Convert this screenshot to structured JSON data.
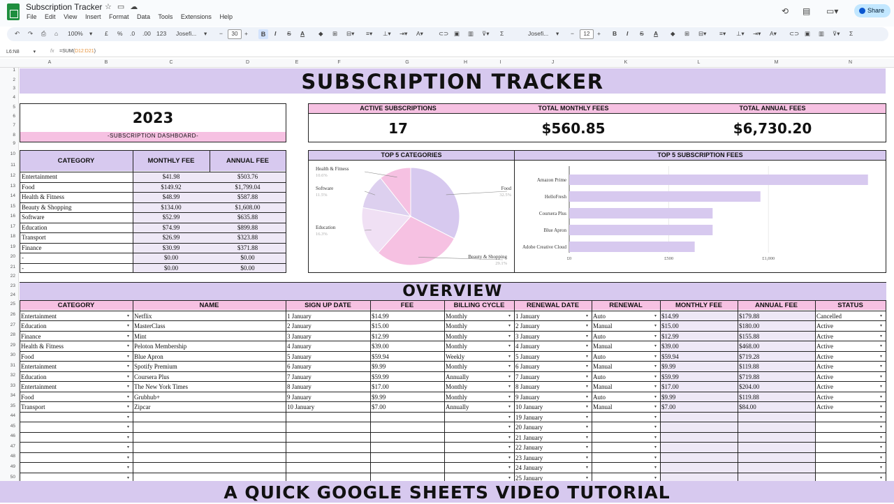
{
  "app": {
    "doc_title": "Subscription Tracker",
    "menu": [
      "File",
      "Edit",
      "View",
      "Insert",
      "Format",
      "Data",
      "Tools",
      "Extensions",
      "Help"
    ],
    "share_label": "Share"
  },
  "toolbar": {
    "zoom": "100%",
    "currency": "£",
    "percent": "%",
    "dec_less": ".0",
    "dec_more": ".00",
    "format_num": "123",
    "font_left": "Josefi...",
    "size_left": "30",
    "font_right": "Josefi...",
    "size_right": "12"
  },
  "formula_bar": {
    "name_box": "L6:N8",
    "fx": "fx",
    "formula_prefix": "=SUM(",
    "formula_range": "D12:D21",
    "formula_suffix": ")"
  },
  "columns": [
    "A",
    "B",
    "C",
    "D",
    "E",
    "F",
    "G",
    "H",
    "I",
    "J",
    "K",
    "L",
    "M",
    "N"
  ],
  "rows": [
    "1",
    "2",
    "3",
    "4",
    "5",
    "6",
    "7",
    "8",
    "9",
    "10",
    "11",
    "12",
    "13",
    "14",
    "15",
    "16",
    "17",
    "18",
    "19",
    "20",
    "21",
    "22",
    "23",
    "24",
    "25",
    "26",
    "27",
    "28",
    "29",
    "30",
    "31",
    "32",
    "33",
    "34",
    "35",
    "44",
    "45",
    "46",
    "47",
    "48",
    "49",
    "50"
  ],
  "header": {
    "title": "SUBSCRIPTION TRACKER"
  },
  "dashboard": {
    "year": "2023",
    "subtitle": "-SUBSCRIPTION DASHBOARD-",
    "kpis": [
      {
        "label": "ACTIVE SUBSCRIPTIONS",
        "value": "17"
      },
      {
        "label": "TOTAL MONTHLY FEES",
        "value": "$560.85"
      },
      {
        "label": "TOTAL ANNUAL FEES",
        "value": "$6,730.20"
      }
    ]
  },
  "category_table": {
    "headers": [
      "CATEGORY",
      "MONTHLY FEE",
      "ANNUAL FEE"
    ],
    "rows": [
      [
        "Entertainment",
        "$41.98",
        "$503.76"
      ],
      [
        "Food",
        "$149.92",
        "$1,799.04"
      ],
      [
        "Health & Fitness",
        "$48.99",
        "$587.88"
      ],
      [
        "Beauty & Shopping",
        "$134.00",
        "$1,608.00"
      ],
      [
        "Software",
        "$52.99",
        "$635.88"
      ],
      [
        "Education",
        "$74.99",
        "$899.88"
      ],
      [
        "Transport",
        "$26.99",
        "$323.88"
      ],
      [
        "Finance",
        "$30.99",
        "$371.88"
      ],
      [
        "-",
        "$0.00",
        "$0.00"
      ],
      [
        "-",
        "$0.00",
        "$0.00"
      ]
    ]
  },
  "chart_data": [
    {
      "type": "pie",
      "title": "TOP 5 CATEGORIES",
      "categories": [
        "Food",
        "Beauty & Shopping",
        "Education",
        "Software",
        "Health & Fitness"
      ],
      "values": [
        32.5,
        29.1,
        16.3,
        11.5,
        10.6
      ],
      "labels": [
        "32.5%",
        "29.1%",
        "16.3%",
        "11.5%",
        "10.6%"
      ],
      "colors": [
        "#d7c9ef",
        "#f6c1e2",
        "#f0e0f4",
        "#ddd0ef",
        "#f6c1e2"
      ]
    },
    {
      "type": "bar",
      "orientation": "horizontal",
      "title": "TOP 5 SUBSCRIPTION FEES",
      "categories": [
        "Amazon Prime",
        "HelloFresh",
        "Coursera Plus",
        "Blue Apron",
        "Adobe Creative Cloud"
      ],
      "values": [
        1500,
        960,
        720,
        720,
        630
      ],
      "xticks": [
        "£0",
        "£500",
        "£1,000"
      ],
      "xlim": [
        0,
        1550
      ],
      "color": "#d7c9ef"
    }
  ],
  "overview": {
    "title": "OVERVIEW",
    "headers": [
      "CATEGORY",
      "NAME",
      "SIGN UP DATE",
      "FEE",
      "BILLING CYCLE",
      "RENEWAL DATE",
      "RENEWAL",
      "MONTHLY FEE",
      "ANNUAL FEE",
      "STATUS"
    ],
    "rows": [
      [
        "Entertainment",
        "Netflix",
        "1 January",
        "$14.99",
        "Monthly",
        "1 January",
        "Auto",
        "$14.99",
        "$179.88",
        "Cancelled"
      ],
      [
        "Education",
        "MasterClass",
        "2 January",
        "$15.00",
        "Monthly",
        "2 January",
        "Manual",
        "$15.00",
        "$180.00",
        "Active"
      ],
      [
        "Finance",
        "Mint",
        "3 January",
        "$12.99",
        "Monthly",
        "3 January",
        "Auto",
        "$12.99",
        "$155.88",
        "Active"
      ],
      [
        "Health & Fitness",
        "Peloton Membership",
        "4 January",
        "$39.00",
        "Monthly",
        "4 January",
        "Manual",
        "$39.00",
        "$468.00",
        "Active"
      ],
      [
        "Food",
        "Blue Apron",
        "5 January",
        "$59.94",
        "Weekly",
        "5 January",
        "Auto",
        "$59.94",
        "$719.28",
        "Active"
      ],
      [
        "Entertainment",
        "Spotify Premium",
        "6 January",
        "$9.99",
        "Monthly",
        "6 January",
        "Manual",
        "$9.99",
        "$119.88",
        "Active"
      ],
      [
        "Education",
        "Coursera Plus",
        "7 January",
        "$59.99",
        "Annually",
        "7 January",
        "Auto",
        "$59.99",
        "$719.88",
        "Active"
      ],
      [
        "Entertainment",
        "The New York Times",
        "8 January",
        "$17.00",
        "Monthly",
        "8 January",
        "Manual",
        "$17.00",
        "$204.00",
        "Active"
      ],
      [
        "Food",
        "Grubhub+",
        "9 January",
        "$9.99",
        "Monthly",
        "9 January",
        "Auto",
        "$9.99",
        "$119.88",
        "Active"
      ],
      [
        "Transport",
        "Zipcar",
        "10 January",
        "$7.00",
        "Annually",
        "10 January",
        "Manual",
        "$7.00",
        "$84.00",
        "Active"
      ],
      [
        "",
        "",
        "",
        "",
        "",
        "19 January",
        "",
        "",
        "",
        ""
      ],
      [
        "",
        "",
        "",
        "",
        "",
        "20 January",
        "",
        "",
        "",
        ""
      ],
      [
        "",
        "",
        "",
        "",
        "",
        "21 January",
        "",
        "",
        "",
        ""
      ],
      [
        "",
        "",
        "",
        "",
        "",
        "22 January",
        "",
        "",
        "",
        ""
      ],
      [
        "",
        "",
        "",
        "",
        "",
        "23 January",
        "",
        "",
        "",
        ""
      ],
      [
        "",
        "",
        "",
        "",
        "",
        "24 January",
        "",
        "",
        "",
        ""
      ],
      [
        "",
        "",
        "",
        "",
        "",
        "25 January",
        "",
        "",
        "",
        ""
      ]
    ]
  },
  "footer": {
    "banner": "A QUICK GOOGLE SHEETS VIDEO TUTORIAL"
  }
}
